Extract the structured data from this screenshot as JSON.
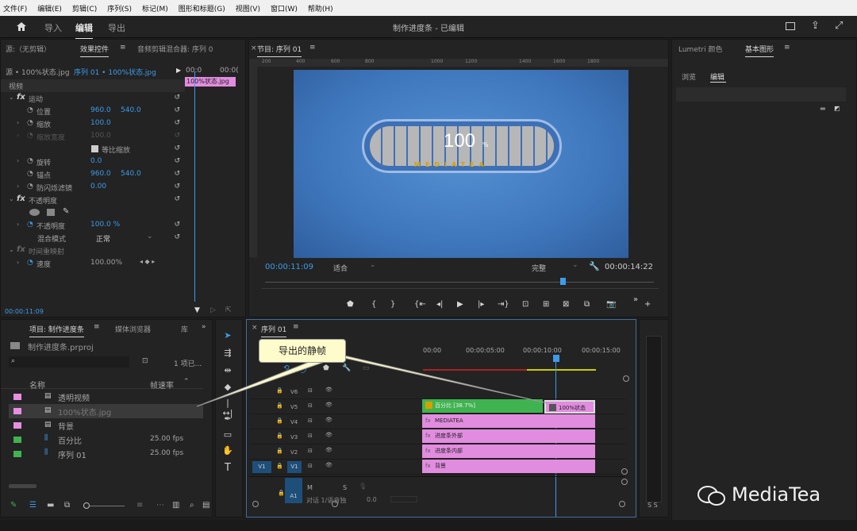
{
  "menu": [
    "文件(F)",
    "编辑(E)",
    "剪辑(C)",
    "序列(S)",
    "标记(M)",
    "图形和标题(G)",
    "视图(V)",
    "窗口(W)",
    "帮助(H)"
  ],
  "workspace": {
    "import": "导入",
    "edit": "编辑",
    "export": "导出",
    "title": "制作进度条 - 已编辑"
  },
  "source": {
    "tab1": "源:（无剪辑）",
    "tab2": "效果控件",
    "tab3": "音频剪辑混合器: 序列 0",
    "clip": "源 • 100%状态.jpg",
    "seq": "序列 01 • 100%状态.jpg",
    "tc_start": "00:0",
    "tc_end": "00:0(",
    "clip_label": "100%状态.jpg",
    "video": "视频",
    "motion": "运动",
    "position": "位置",
    "pos_x": "960.0",
    "pos_y": "540.0",
    "scale": "缩放",
    "scale_v": "100.0",
    "scale_w": "缩放宽度",
    "scale_w_v": "100.0",
    "uniform": "等比缩放",
    "rotation": "旋转",
    "rot_v": "0.0",
    "anchor": "锚点",
    "anc_x": "960.0",
    "anc_y": "540.0",
    "flicker": "防闪烁滤镜",
    "flicker_v": "0.00",
    "opacity": "不透明度",
    "opacity_p": "不透明度",
    "opacity_v": "100.0 %",
    "blend": "混合模式",
    "blend_v": "正常",
    "remap": "时间重映射",
    "speed": "速度",
    "speed_v": "100.00%",
    "timecode": "00:00:11:09"
  },
  "program": {
    "tab": "节目: 序列 01",
    "ruler": [
      "200",
      "400",
      "600",
      "800",
      "1000",
      "1200",
      "1400",
      "1600",
      "1800"
    ],
    "big": "100",
    "pct": "%",
    "logo": "MEDIATEA",
    "tc": "00:00:11:09",
    "fit": "适合",
    "full": "完整",
    "duration": "00:00:14:22"
  },
  "right": {
    "tab1": "Lumetri 颜色",
    "tab2": "基本图形",
    "sub1": "浏览",
    "sub2": "编辑"
  },
  "project": {
    "tab1": "项目: 制作进度条",
    "tab2": "媒体浏览器",
    "tab3": "库",
    "file": "制作进度条.prproj",
    "count": "1 项已...",
    "col_name": "名称",
    "col_rate": "帧速率",
    "items": [
      {
        "name": "透明视频",
        "rate": "",
        "color": "#e88ee0"
      },
      {
        "name": "100%状态.jpg",
        "rate": "",
        "color": "#e88ee0"
      },
      {
        "name": "背景",
        "rate": "",
        "color": "#e88ee0"
      },
      {
        "name": "百分比",
        "rate": "25.00 fps",
        "color": "#3fb34f"
      },
      {
        "name": "序列 01",
        "rate": "25.00 fps",
        "color": "#3fb34f"
      }
    ]
  },
  "timeline": {
    "tab": "序列 01",
    "callout": "导出的静帧",
    "ruler": [
      "00:00",
      "00:00:05:00",
      "00:00:10:00",
      "00:00:15:00"
    ],
    "tracks": [
      "V6",
      "V5",
      "V4",
      "V3",
      "V2",
      "V1"
    ],
    "a1": "A1",
    "m": "M",
    "s": "S",
    "a_label": "对话 1/语音独",
    "a_val": "0.0",
    "clips": [
      "百分比 [38.7%]",
      "100%状态",
      "MEDIATEA",
      "进度条外部",
      "进度条内部",
      "背景"
    ],
    "meter": "S S"
  },
  "brand": "MediaTea"
}
